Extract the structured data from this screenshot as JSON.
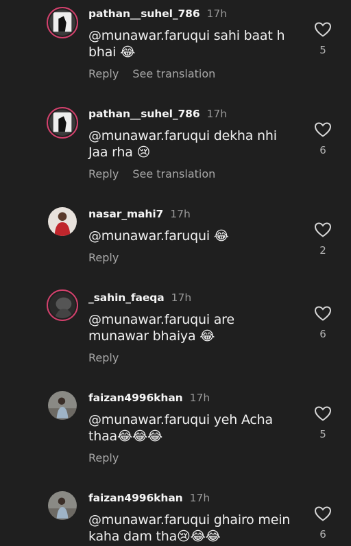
{
  "comments": [
    {
      "username": "pathan__suhel_786",
      "time": "17h",
      "text": "@munawar.faruqui sahi baat h bhai 😂",
      "likes": "5",
      "reply": "Reply",
      "translate": "See translation"
    },
    {
      "username": "pathan__suhel_786",
      "time": "17h",
      "text": "@munawar.faruqui dekha nhi Jaa rha 😢",
      "likes": "6",
      "reply": "Reply",
      "translate": "See translation"
    },
    {
      "username": "nasar_mahi7",
      "time": "17h",
      "text": "@munawar.faruqui 😂",
      "likes": "2",
      "reply": "Reply"
    },
    {
      "username": "_sahin_faeqa",
      "time": "17h",
      "text": "@munawar.faruqui are munawar bhaiya 😂",
      "likes": "6",
      "reply": "Reply"
    },
    {
      "username": "faizan4996khan",
      "time": "17h",
      "text": "@munawar.faruqui yeh Acha thaa😂😂😂",
      "likes": "5",
      "reply": "Reply"
    },
    {
      "username": "faizan4996khan",
      "time": "17h",
      "text": "@munawar.faruqui ghairo mein kaha dam tha😢😂😂",
      "likes": "6"
    }
  ],
  "colors": {
    "background": "#1f1f1f",
    "story_ring": "#d3416d",
    "muted": "#a8a8a8"
  }
}
